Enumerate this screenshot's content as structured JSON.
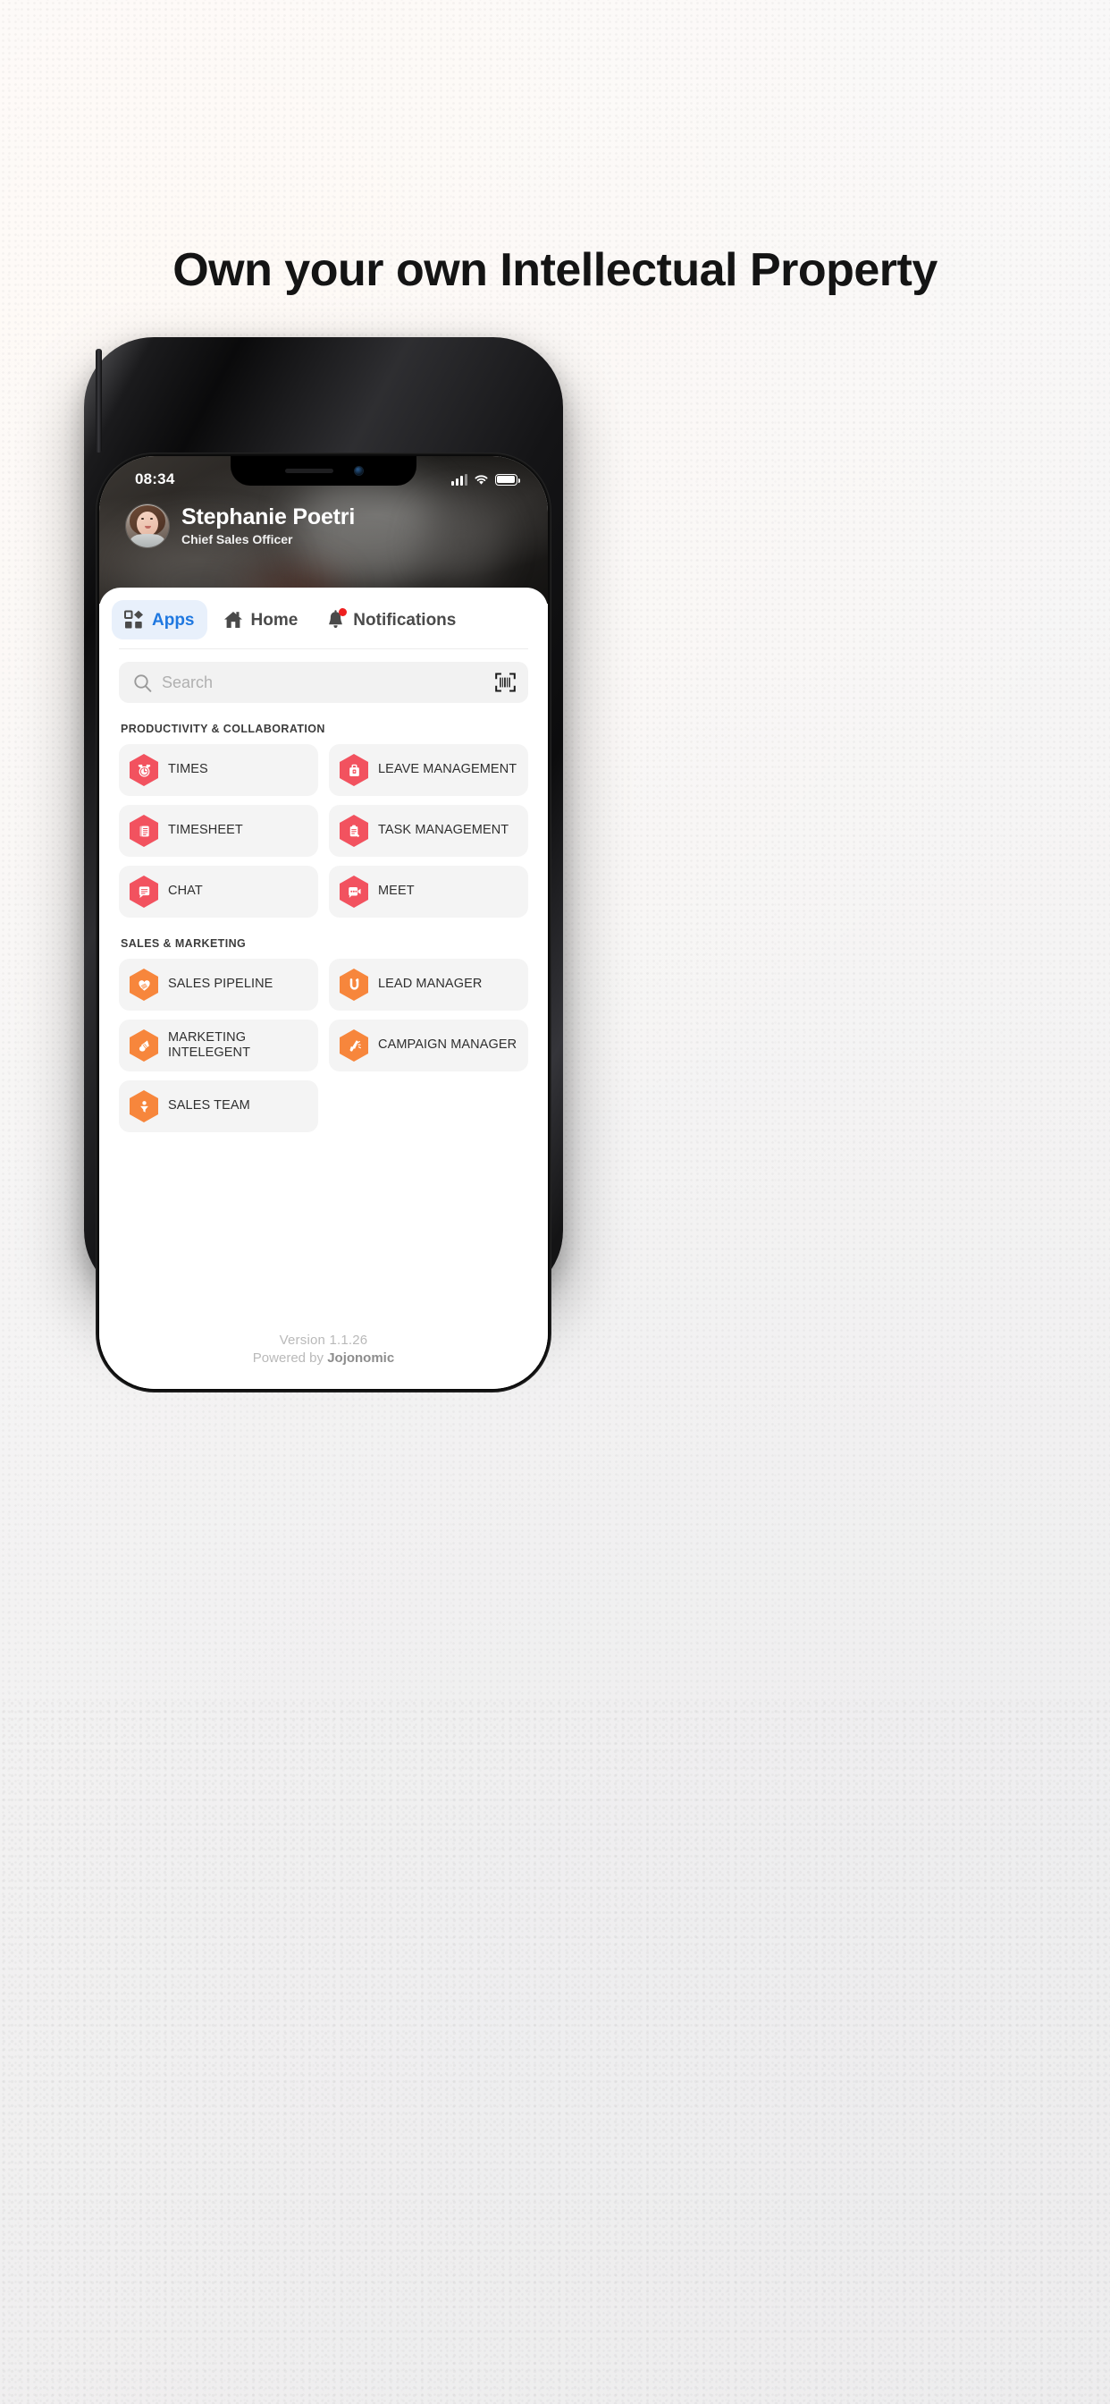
{
  "headline": "Own your own Intellectual Property",
  "phone": {
    "status_bar": {
      "time": "08:34",
      "signal_icon": "cellular-signal-icon",
      "wifi_icon": "wifi-icon",
      "battery_icon": "battery-icon"
    },
    "profile": {
      "avatar": "user-avatar",
      "name": "Stephanie Poetri",
      "role": "Chief Sales Officer"
    },
    "tabs": [
      {
        "label": "Apps",
        "icon": "apps-grid-icon",
        "active": true
      },
      {
        "label": "Home",
        "icon": "home-icon",
        "active": false
      },
      {
        "label": "Notifications",
        "icon": "bell-icon",
        "active": false,
        "badge": true
      }
    ],
    "search": {
      "placeholder": "Search",
      "value": "",
      "search_icon": "search-icon",
      "scan_icon": "barcode-scan-icon"
    },
    "sections": [
      {
        "title": "PRODUCTIVITY & COLLABORATION",
        "color": "#f2525f",
        "apps": [
          {
            "label": "TIMES",
            "icon": "alarm-clock-icon"
          },
          {
            "label": "LEAVE MANAGEMENT",
            "icon": "suitcase-icon"
          },
          {
            "label": "TIMESHEET",
            "icon": "document-list-icon"
          },
          {
            "label": "TASK MANAGEMENT",
            "icon": "clipboard-pen-icon"
          },
          {
            "label": "CHAT",
            "icon": "chat-bubble-icon"
          },
          {
            "label": "MEET",
            "icon": "video-chat-icon"
          }
        ]
      },
      {
        "title": "SALES & MARKETING",
        "color": "#f7863c",
        "apps": [
          {
            "label": "SALES PIPELINE",
            "icon": "heart-funnel-icon"
          },
          {
            "label": "LEAD MANAGER",
            "icon": "magnet-icon"
          },
          {
            "label": "MARKETING INTELEGENT",
            "icon": "megaphone-icon"
          },
          {
            "label": "CAMPAIGN MANAGER",
            "icon": "campaign-horn-icon"
          },
          {
            "label": "SALES TEAM",
            "icon": "person-funnel-icon"
          }
        ]
      }
    ],
    "footer": {
      "version": "Version 1.1.26",
      "powered_prefix": "Powered by ",
      "powered_brand": "Jojonomic"
    }
  },
  "colors": {
    "accent_blue": "#1f78e0",
    "tab_active_bg": "#e8f0fb",
    "red_app": "#f2525f",
    "orange_app": "#f7863c",
    "card_bg": "#f4f4f4",
    "badge_red": "#ee2020"
  }
}
